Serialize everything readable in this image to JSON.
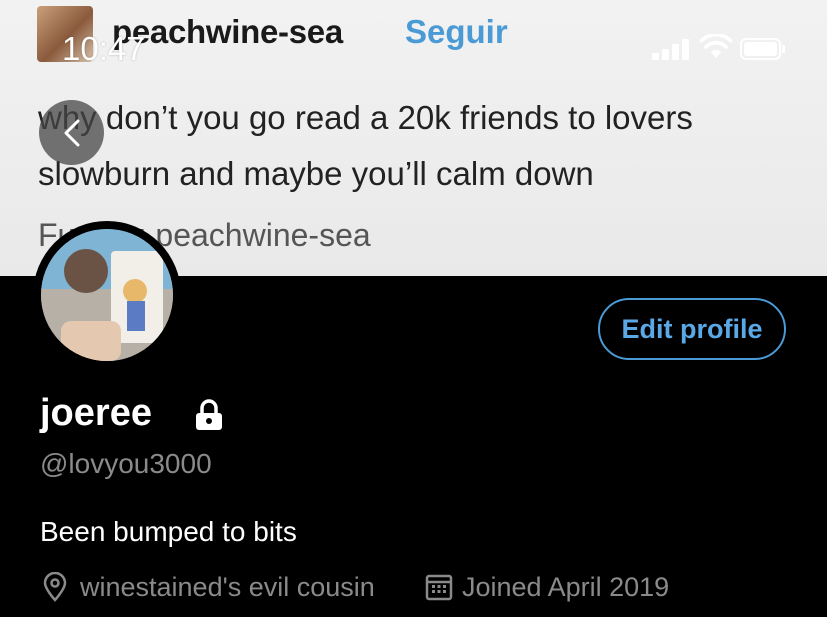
{
  "post": {
    "username": "peachwine-sea",
    "follow_label": "Seguir",
    "text": "why don’t you go read a 20k friends to lovers slowburn and maybe you’ll calm down",
    "source_label": "Fuente: peachwine-sea"
  },
  "status_bar": {
    "time": "10:47",
    "signal_icon": "signal-bars",
    "wifi_icon": "wifi",
    "battery_icon": "battery"
  },
  "profile": {
    "display_name": "joeree",
    "handle": "@lovyou3000",
    "bio": "Been bumped to bits",
    "location": "winestained's evil cousin",
    "joined": "Joined April 2019",
    "edit_profile_label": "Edit profile",
    "protected_icon": "lock"
  },
  "colors": {
    "accent": "#4a9ad6",
    "background": "#000000",
    "secondary_text": "#8a8a8a"
  }
}
